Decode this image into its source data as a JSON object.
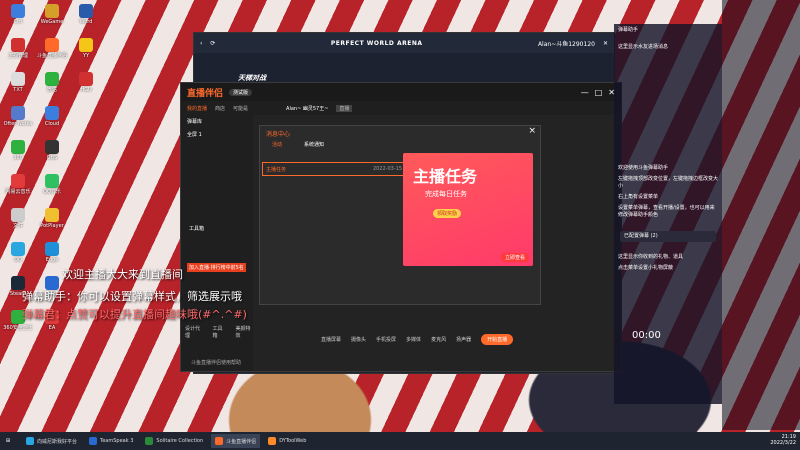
{
  "desktop_icons": [
    {
      "label": "Ctrl",
      "color": "#3c7ede"
    },
    {
      "label": "卫视管理",
      "color": "#d03030"
    },
    {
      "label": "TXT",
      "color": "#dddddd"
    },
    {
      "label": "Ofter Notes",
      "color": "#557acc"
    },
    {
      "label": "360",
      "color": "#2fb13f"
    },
    {
      "label": "网易云音乐",
      "color": "#e33b3b"
    },
    {
      "label": "文件",
      "color": "#cccccc"
    },
    {
      "label": "QQ",
      "color": "#2aa6e0"
    },
    {
      "label": "Steam",
      "color": "#1b2838"
    },
    {
      "label": "360安全卫士",
      "color": "#2fb13f"
    },
    {
      "label": "WeGame",
      "color": "#d4a02a"
    },
    {
      "label": "斗鱼直播伴侣",
      "color": "#ff6a2a"
    },
    {
      "label": "微信",
      "color": "#2fb13f"
    },
    {
      "label": "Cloud",
      "color": "#3c7ede"
    },
    {
      "label": "OBS",
      "color": "#333333"
    },
    {
      "label": "QQ音乐",
      "color": "#2fc161"
    },
    {
      "label": "PotPlayer",
      "color": "#f0c030"
    },
    {
      "label": "Edge",
      "color": "#1f8fd8"
    },
    {
      "label": "2021",
      "color": "#2a6ad0"
    },
    {
      "label": "EA",
      "color": "#e33b3b"
    },
    {
      "label": "Word",
      "color": "#2a5aaa"
    },
    {
      "label": "YY",
      "color": "#f5c518"
    },
    {
      "label": "HGU",
      "color": "#d03030"
    }
  ],
  "arena": {
    "title": "PERFECT WORLD ARENA",
    "user": "Alan~斗鱼1290120",
    "tag": "天梯对战"
  },
  "assistant": {
    "logo": "直播伴侣",
    "version": "测试版",
    "tabs": [
      "我的直播",
      "商店",
      "可能是"
    ],
    "stream_name": "Alan~ 幽灵57王~",
    "stream_tag": "直播",
    "left_items": [
      "弹幕库",
      "全屏 1"
    ],
    "tool_label": "工具箱",
    "ranking_banner": "加入直播·排行榜中前5名",
    "bottom_left": [
      "设计代理",
      "工具箱",
      "美颜特效"
    ],
    "status_text": "斗鱼直播伴侣使用帮助",
    "bottom_tools": [
      "直播屏幕",
      "摄像头",
      "手机投屏",
      "多媒体",
      "麦克风",
      "扬声器"
    ],
    "start_live": "开始直播"
  },
  "notice": {
    "title": "消息中心",
    "tabs": [
      "活动",
      "系统通知"
    ],
    "item_title": "主播任务",
    "item_date": "2022-03-15",
    "banner_title": "主播任务",
    "banner_sub": "完成每日任务",
    "banner_btn": "领取奖励",
    "banner_corner": "立即查看"
  },
  "danmu_panel": {
    "title": "弹幕助手",
    "lines": [
      "这里显示水友进场消息",
      "欢迎使用斗鱼弹幕助手",
      "左键拖拽顶部改变位置，左键拖拽边框改变大小",
      "右上角有设置菜单",
      "设置菜单弹幕，查看开播/设置，也可以用来修改弹幕助手颜色",
      "已配置弹幕 (2)",
      "这里显示你收到的礼物、道具",
      "点击菜单设置小礼物屏蔽"
    ],
    "time": "00:00"
  },
  "chat_overlay": [
    {
      "text": "欢迎主播大大来到直播间",
      "color": "#ffffff"
    },
    {
      "text": "弹幕助手：你可以设置弹幕样式，筛选展示哦",
      "color": "#ffffff"
    },
    {
      "text": "弹幕君：点赞可以提升直播间趣味哦(#^.^#)",
      "color": "#ff6a6a"
    }
  ],
  "taskbar": {
    "items": [
      {
        "label": "向威尼斯我好平台",
        "color": "#2aa6e0"
      },
      {
        "label": "TeamSpeak 3",
        "color": "#2a6ad0"
      },
      {
        "label": "Solitaire Collection",
        "color": "#2a8a3a"
      },
      {
        "label": "斗鱼直播伴侣",
        "color": "#ff6a2a"
      },
      {
        "label": "DYToolWeb",
        "color": "#ff8a2a"
      }
    ],
    "time": "21:19",
    "date": "2022/3/22"
  }
}
